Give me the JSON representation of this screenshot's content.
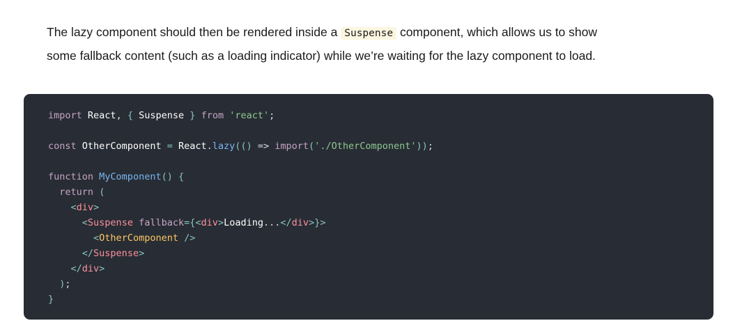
{
  "paragraph": {
    "before": "The lazy component should then be rendered inside a ",
    "inline_code": "Suspense",
    "after": " component, which allows us to show some fallback content (such as a loading indicator) while we’re waiting for the lazy component to load."
  },
  "code": {
    "language": "javascript",
    "lines": [
      "import React, { Suspense } from 'react';",
      "",
      "const OtherComponent = React.lazy(() => import('./OtherComponent'));",
      "",
      "function MyComponent() {",
      "  return (",
      "    <div>",
      "      <Suspense fallback={<div>Loading...</div>}>",
      "        <OtherComponent />",
      "      </Suspense>",
      "    </div>",
      "  );",
      "}"
    ],
    "colors": {
      "background": "#282c34",
      "keyword": "#c5a5c5",
      "string": "#8dc891",
      "function": "#79b6f2",
      "tag": "#fc929e",
      "component": "#fac863",
      "punctuation": "#88c6be",
      "plain": "#ffffff"
    }
  }
}
